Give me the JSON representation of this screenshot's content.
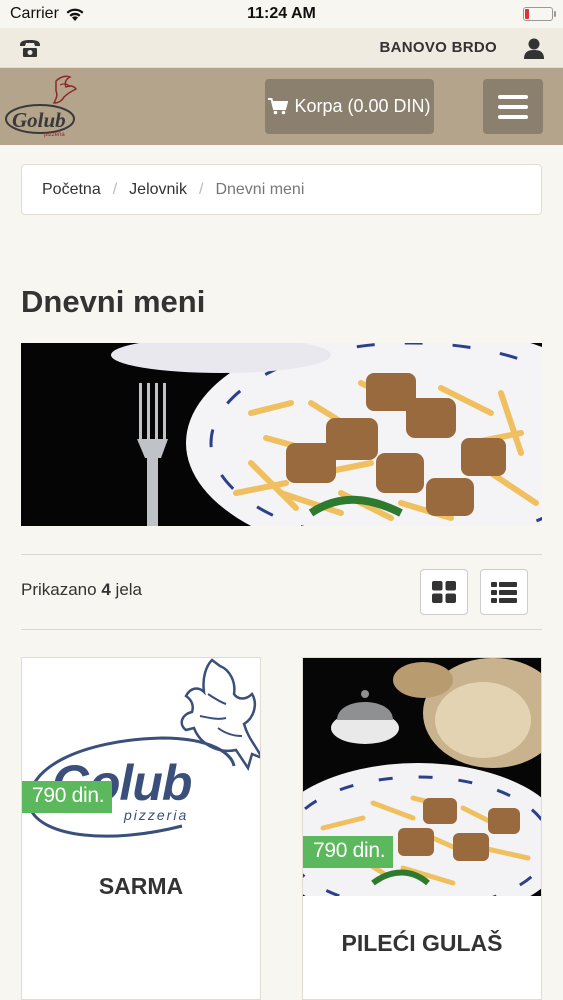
{
  "status": {
    "carrier": "Carrier",
    "time": "11:24 AM"
  },
  "topbar": {
    "location": "BANOVO BRDO"
  },
  "navbar": {
    "logo_text": "Golub",
    "cart_label": "Korpa (0.00 DIN)"
  },
  "breadcrumb": [
    "Početna",
    "Jelovnik",
    "Dnevni meni"
  ],
  "page": {
    "title": "Dnevni meni"
  },
  "listing": {
    "count_prefix": "Prikazano",
    "count": "4",
    "count_suffix": "jela"
  },
  "products": [
    {
      "name": "SARMA",
      "price": "790 din.",
      "image": "golub-pizzeria-logo"
    },
    {
      "name": "PILEĆI GULAŠ",
      "price": "790 din.",
      "image": "goulash-pasta-photo"
    }
  ],
  "colors": {
    "navbar": "#b3a48b",
    "button": "#8b7f6d",
    "price_badge": "#5cb85c",
    "brand_blue": "#3a4f7a"
  }
}
